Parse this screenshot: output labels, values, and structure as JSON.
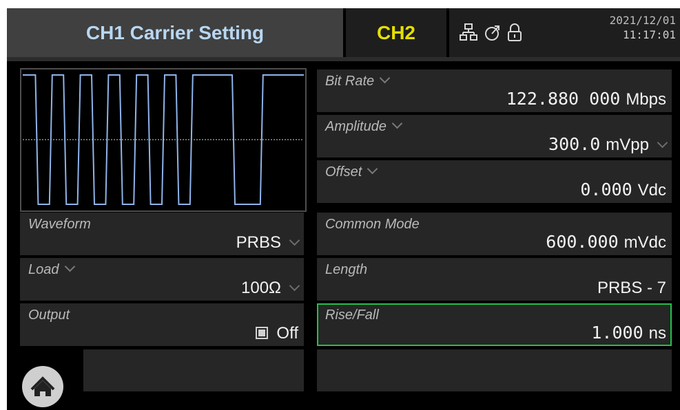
{
  "header": {
    "ch1_title": "CH1 Carrier Setting",
    "ch2_tab": "CH2",
    "date": "2021/12/01",
    "time": "11:17:01",
    "icons": [
      "network-icon",
      "sync-icon",
      "lock-icon"
    ]
  },
  "left": {
    "waveform": {
      "label": "Waveform",
      "value": "PRBS"
    },
    "load": {
      "label": "Load",
      "value": "100Ω"
    },
    "output": {
      "label": "Output",
      "value": "Off"
    }
  },
  "right": {
    "bit_rate": {
      "label": "Bit Rate",
      "value": "122.880 000",
      "unit": "Mbps"
    },
    "amplitude": {
      "label": "Amplitude",
      "value": "300.0",
      "unit": "mVpp"
    },
    "offset": {
      "label": "Offset",
      "value": "0.000",
      "unit": "Vdc"
    },
    "common_mode": {
      "label": "Common Mode",
      "value": "600.000",
      "unit": "mVdc"
    },
    "length": {
      "label": "Length",
      "value": "PRBS - 7"
    },
    "rise_fall": {
      "label": "Rise/Fall",
      "value": "1.000",
      "unit": "ns"
    }
  },
  "preview": {
    "bits": [
      1,
      0,
      1,
      0,
      1,
      0,
      1,
      0,
      1,
      0,
      1,
      0,
      1,
      1,
      1,
      0,
      0,
      1,
      1,
      1
    ],
    "line_color": "#8fb4ea",
    "midline_color": "#d8d8d8"
  },
  "colors": {
    "ch1_text": "#b8d7f2",
    "ch2_text": "#e5e000",
    "selection": "#23c04a"
  }
}
